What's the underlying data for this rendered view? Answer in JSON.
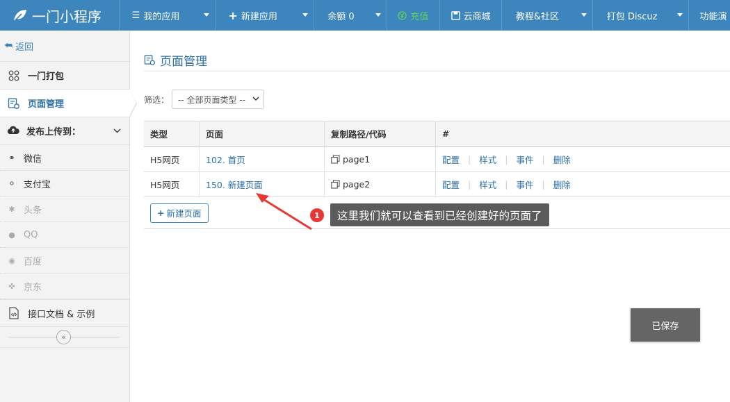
{
  "app": {
    "title": "一门小程序"
  },
  "nav": {
    "items": [
      {
        "label": "我的应用",
        "icon": "menu-icon",
        "caret": true
      },
      {
        "label": "新建应用",
        "icon": "plus-icon",
        "caret": true
      },
      {
        "label": "余额 0",
        "icon": "",
        "caret": true
      },
      {
        "label": "充值",
        "icon": "yen-circle-icon",
        "caret": false
      },
      {
        "label": "云商城",
        "icon": "save-icon",
        "caret": false
      },
      {
        "label": "教程&社区",
        "icon": "",
        "caret": true
      },
      {
        "label": "打包 Discuz",
        "icon": "",
        "caret": true
      },
      {
        "label": "功能演",
        "icon": "",
        "caret": false
      }
    ]
  },
  "sidebar": {
    "back": "返回",
    "items": [
      {
        "label": "一门打包"
      },
      {
        "label": "页面管理"
      }
    ],
    "publish": "发布上传到：",
    "platforms": [
      {
        "label": "微信",
        "dim": false
      },
      {
        "label": "支付宝",
        "dim": false
      },
      {
        "label": "头条",
        "dim": true
      },
      {
        "label": "QQ",
        "dim": true
      },
      {
        "label": "百度",
        "dim": true
      },
      {
        "label": "京东",
        "dim": true
      }
    ],
    "docs": "接口文档 & 示例"
  },
  "main": {
    "title": "页面管理",
    "filter_label": "筛选：",
    "filter_value": "-- 全部页面类型 --",
    "columns": [
      "类型",
      "页面",
      "复制路径/代码",
      "#"
    ],
    "rows": [
      {
        "type": "H5网页",
        "page": "102. 首页",
        "path": "page1"
      },
      {
        "type": "H5网页",
        "page": "150. 新建页面",
        "path": "page2"
      }
    ],
    "ops": [
      "配置",
      "样式",
      "事件",
      "删除"
    ],
    "new_page": "新建页面",
    "saved": "已保存"
  },
  "annotation": {
    "badge": "1",
    "text": "这里我们就可以查看到已经创建好的页面了"
  },
  "colors": {
    "nav_bg": "#3c85bd",
    "link": "#2b6fa6",
    "badge": "#e53935",
    "saved_bg": "#656565"
  }
}
